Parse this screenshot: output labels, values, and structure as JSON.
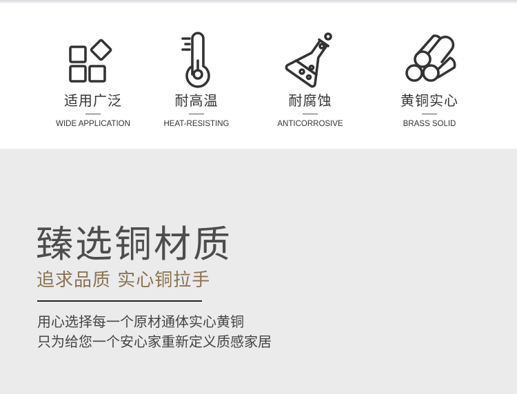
{
  "features": [
    {
      "icon": "grid-shapes-icon",
      "title_zh": "适用广泛",
      "title_en": "WIDE APPLICATION"
    },
    {
      "icon": "thermometer-icon",
      "title_zh": "耐高温",
      "title_en": "HEAT-RESISTING"
    },
    {
      "icon": "flask-icon",
      "title_zh": "耐腐蚀",
      "title_en": "ANTICORROSIVE"
    },
    {
      "icon": "brass-rods-icon",
      "title_zh": "黄铜实心",
      "title_en": "BRASS SOLID"
    }
  ],
  "section": {
    "headline": "臻选铜材质",
    "subline": "追求品质 实心铜拉手",
    "desc_line1": "用心选择每一个原材通体实心黄铜",
    "desc_line2": "只为给您一个安心家重新定义质感家居"
  },
  "colors": {
    "icon_stroke": "#333333",
    "headline": "#4d4d4d",
    "accent_gold": "#8a7350",
    "lower_bg": "#ebebeb"
  }
}
